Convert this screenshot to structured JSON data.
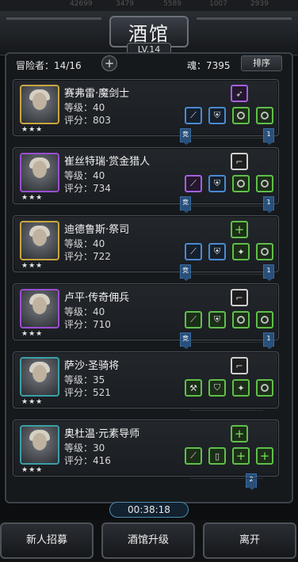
{
  "topbar": {
    "resources": [
      "42699",
      "3479",
      "5589",
      "1007",
      "2939"
    ]
  },
  "header": {
    "title": "酒馆",
    "level": "LV.14"
  },
  "stats": {
    "adventurers_label": "冒险者：14/16",
    "soul_label": "魂：7395",
    "sort_label": "排序",
    "add_glyph": "+"
  },
  "adventurers": [
    {
      "name": "赛弗雷·魔剑士",
      "level": "等级：40",
      "score": "评分：803",
      "stars": "★★★",
      "frame_color": "#c9a640",
      "ribbon_left": "竞",
      "ribbon_right": "1",
      "top_slot": {
        "color": "purple",
        "icon": "feather-icon"
      },
      "slots": [
        {
          "color": "blue",
          "icon": "sword-icon"
        },
        {
          "color": "blue",
          "icon": "armor-icon"
        },
        {
          "color": "plus",
          "icon": "ring-icon"
        },
        {
          "color": "plus",
          "icon": "ring-icon"
        }
      ]
    },
    {
      "name": "崔丝特瑞·赏金猎人",
      "level": "等级：40",
      "score": "评分：734",
      "stars": "★★★",
      "frame_color": "#9a4fd0",
      "ribbon_left": "竞",
      "ribbon_right": "1",
      "top_slot": {
        "color": "white",
        "icon": "boot-icon"
      },
      "slots": [
        {
          "color": "purple",
          "icon": "blade-icon"
        },
        {
          "color": "blue",
          "icon": "armor-icon"
        },
        {
          "color": "plus",
          "icon": "ring-icon"
        },
        {
          "color": "plus",
          "icon": "ring-icon"
        }
      ]
    },
    {
      "name": "迪德鲁斯·祭司",
      "level": "等级：40",
      "score": "评分：722",
      "stars": "★★★",
      "frame_color": "#c9a640",
      "ribbon_left": "竞",
      "ribbon_right": "1",
      "top_slot": {
        "color": "plus",
        "icon": "plus-icon"
      },
      "slots": [
        {
          "color": "blue",
          "icon": "staff-icon"
        },
        {
          "color": "blue",
          "icon": "armor-icon"
        },
        {
          "color": "plus",
          "icon": "gem-icon"
        },
        {
          "color": "plus",
          "icon": "ring-icon"
        }
      ]
    },
    {
      "name": "卢平·传奇佣兵",
      "level": "等级：40",
      "score": "评分：710",
      "stars": "★★★",
      "frame_color": "#9a4fd0",
      "ribbon_left": "竞",
      "ribbon_right": "1",
      "top_slot": {
        "color": "white",
        "icon": "boot-icon"
      },
      "slots": [
        {
          "color": "plus",
          "icon": "blade-icon"
        },
        {
          "color": "plus",
          "icon": "armor-icon"
        },
        {
          "color": "plus",
          "icon": "ring-icon"
        },
        {
          "color": "plus",
          "icon": "ring-icon"
        }
      ]
    },
    {
      "name": "萨沙·圣骑将",
      "level": "等级：35",
      "score": "评分：521",
      "stars": "★★★",
      "frame_color": "#3aa0a8",
      "ribbon_left": "",
      "ribbon_right": "",
      "top_slot": {
        "color": "white",
        "icon": "boot-icon"
      },
      "slots": [
        {
          "color": "plus",
          "icon": "axe-icon"
        },
        {
          "color": "plus",
          "icon": "shield-icon"
        },
        {
          "color": "plus",
          "icon": "gem-icon"
        },
        {
          "color": "plus",
          "icon": "ring-icon"
        }
      ]
    },
    {
      "name": "奥杜温·元素导师",
      "level": "等级：30",
      "score": "评分：416",
      "stars": "★★★",
      "frame_color": "#3aa0a8",
      "ribbon_left": "",
      "ribbon_right": "2",
      "top_slot": {
        "color": "plus",
        "icon": "plus-icon"
      },
      "slots": [
        {
          "color": "plus",
          "icon": "staff-icon"
        },
        {
          "color": "plus",
          "icon": "robe-icon"
        },
        {
          "color": "plus",
          "icon": "plus-icon"
        },
        {
          "color": "plus",
          "icon": "plus-icon"
        }
      ]
    }
  ],
  "timer": "00:38:18",
  "buttons": {
    "recruit": "新人招募",
    "upgrade": "酒馆升级",
    "leave": "离开"
  }
}
